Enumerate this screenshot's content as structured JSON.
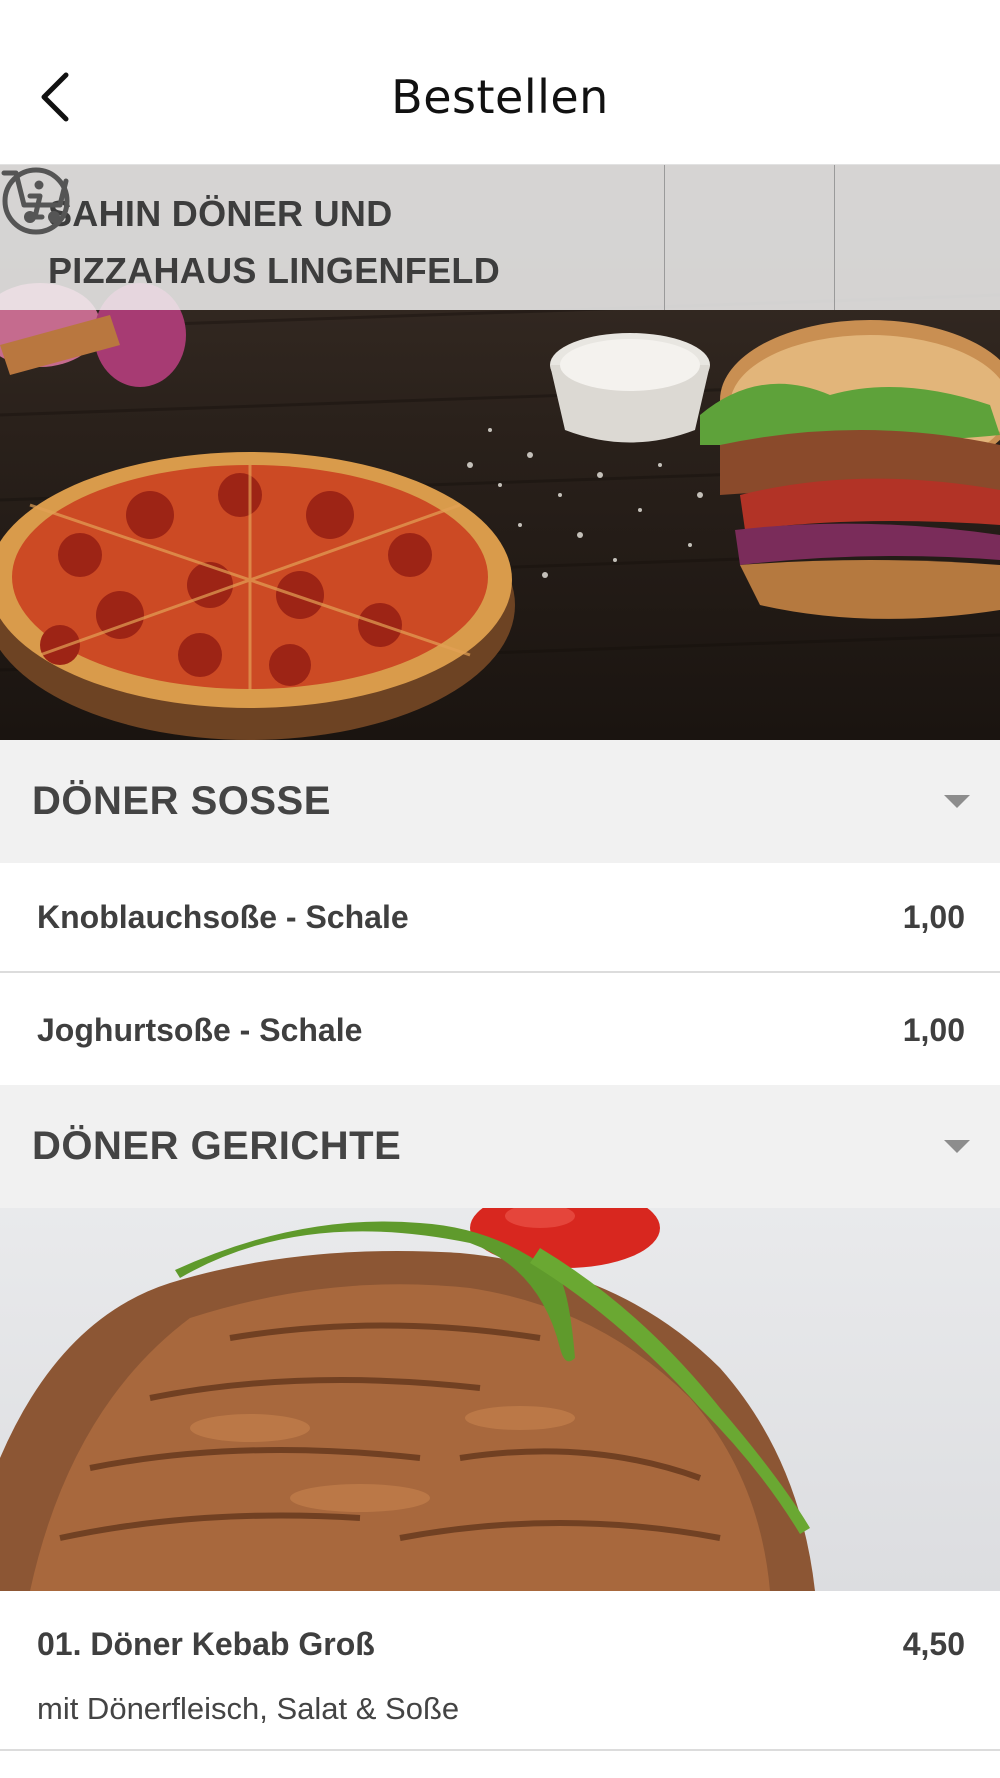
{
  "header": {
    "title": "Bestellen",
    "back_icon": "chevron-left-icon"
  },
  "restaurant": {
    "name_line1": "SAHIN DÖNER UND",
    "name_line2": "PIZZAHAUS LINGENFELD",
    "info_icon": "info-circle-icon",
    "cart_icon": "cart-icon"
  },
  "menu": {
    "categories": [
      {
        "label": "DÖNER SOSSE",
        "items": [
          {
            "name": "Knoblauchsoße - Schale",
            "price": "1,00"
          },
          {
            "name": "Joghurtsoße - Schale",
            "price": "1,00"
          }
        ]
      },
      {
        "label": "DÖNER GERICHTE",
        "items": [
          {
            "name": "01. Döner Kebab Groß",
            "price": "4,50",
            "description": "mit Dönerfleisch, Salat & Soße"
          }
        ]
      }
    ]
  },
  "colors": {
    "category_bg": "#f1f1f1",
    "text_dark": "#3f3f3f",
    "divider": "#dcdcdc"
  }
}
